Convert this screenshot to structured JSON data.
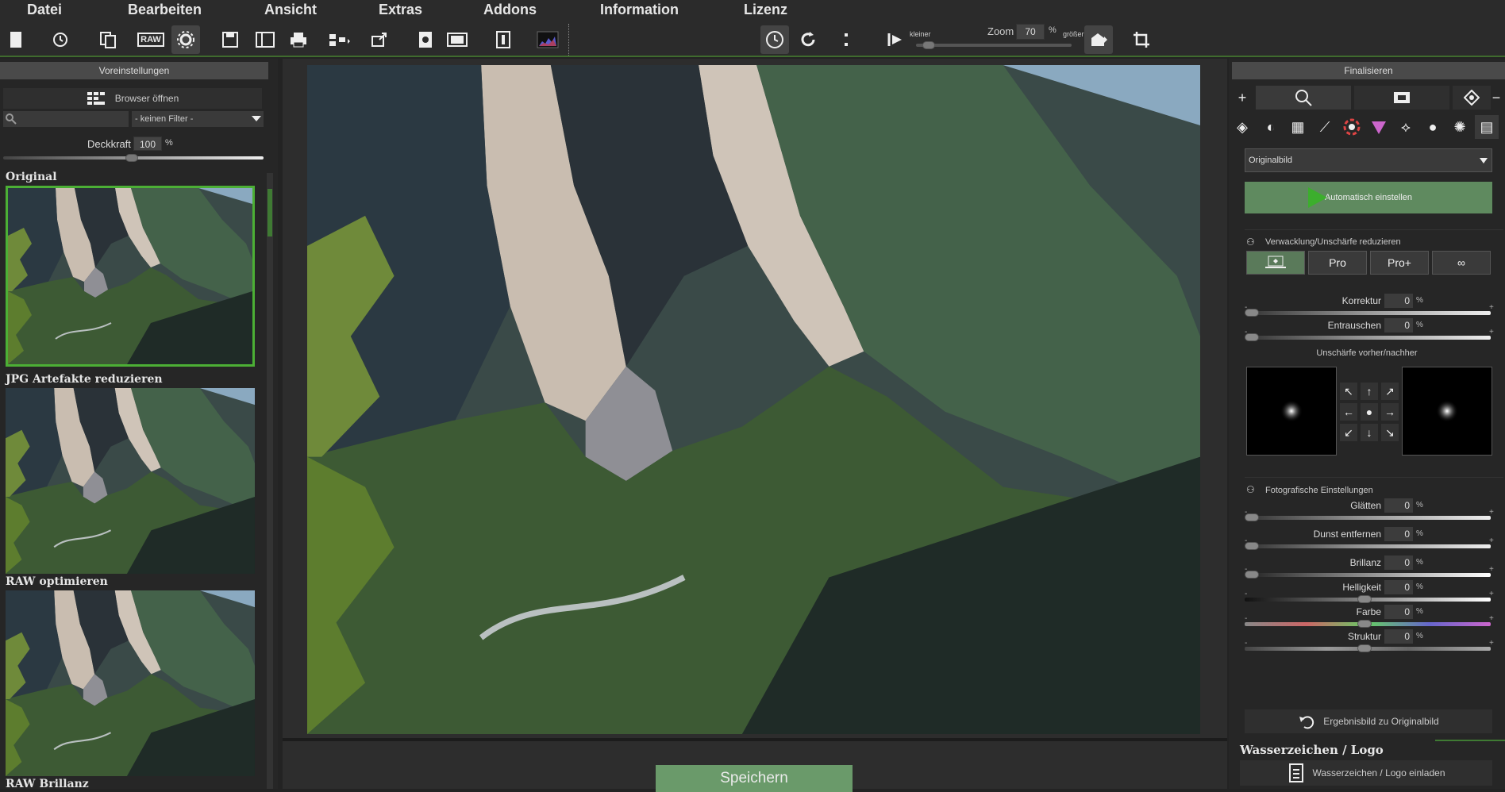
{
  "menu": {
    "items": [
      "Datei",
      "Bearbeiten",
      "Ansicht",
      "Extras",
      "Addons",
      "Information",
      "Lizenz"
    ]
  },
  "toolbar": {
    "icons": [
      "new-file-icon",
      "history-icon",
      "copy-icon",
      "raw-settings-icon",
      "presets-gear-icon",
      "save-icon",
      "save-as-icon",
      "print-icon",
      "export-icon",
      "share-icon",
      "batch-icon",
      "compare-icon",
      "info-icon",
      "histogram-icon"
    ],
    "raw_label": "RAW",
    "zoom_label": "Zoom",
    "zoom_value": "70",
    "zoom_unit": "%",
    "smaller_label": "kleiner",
    "larger_label": "größer"
  },
  "left_panel": {
    "title": "Voreinstellungen",
    "browser_button": "Browser öffnen",
    "filter_value": "- keinen Filter -",
    "opacity_label": "Deckkraft",
    "opacity_value": "100",
    "opacity_unit": "%",
    "presets": [
      {
        "label": "Original",
        "selected": true
      },
      {
        "label": "JPG Artefakte reduzieren",
        "selected": false
      },
      {
        "label": "RAW optimieren",
        "selected": false
      },
      {
        "label": "RAW Brillanz",
        "selected": false
      }
    ]
  },
  "center": {
    "save_button": "Speichern"
  },
  "right_panel": {
    "title": "Finalisieren",
    "select_value": "Originalbild",
    "auto_button": "Automatisch einstellen",
    "section_shake": "Verwacklung/Unschärfe reduzieren",
    "mode_buttons": [
      "",
      "Pro",
      "Pro+",
      "∞"
    ],
    "sliders_shake": [
      {
        "label": "Korrektur",
        "value": "0"
      },
      {
        "label": "Entrauschen",
        "value": "0"
      }
    ],
    "blur_label": "Unschärfe vorher/nachher",
    "section_photo": "Fotografische Einstellungen",
    "sliders_photo": [
      {
        "label": "Glätten",
        "value": "0"
      },
      {
        "label": "Dunst entfernen",
        "value": "0"
      },
      {
        "label": "Brillanz",
        "value": "0"
      },
      {
        "label": "Helligkeit",
        "value": "0"
      },
      {
        "label": "Farbe",
        "value": "0"
      },
      {
        "label": "Struktur",
        "value": "0"
      }
    ],
    "percent": "%",
    "reset_button": "Ergebnisbild zu Originalbild",
    "watermark_title": "Wasserzeichen / Logo",
    "watermark_button": "Wasserzeichen / Logo einladen"
  }
}
